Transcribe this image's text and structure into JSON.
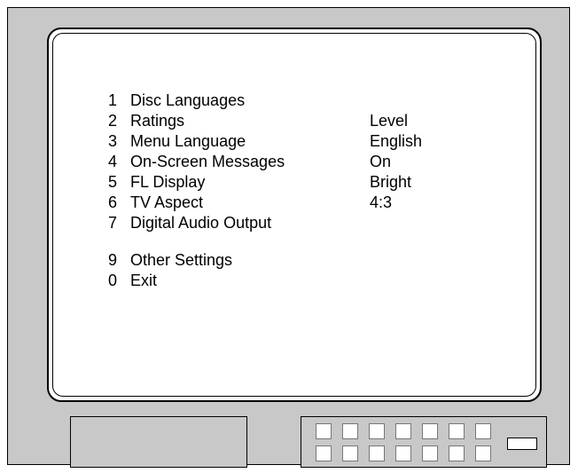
{
  "menu": {
    "items": [
      {
        "num": "1",
        "label": "Disc Languages",
        "value": ""
      },
      {
        "num": "2",
        "label": "Ratings",
        "value": "Level"
      },
      {
        "num": "3",
        "label": "Menu Language",
        "value": "English"
      },
      {
        "num": "4",
        "label": "On-Screen Messages",
        "value": "On"
      },
      {
        "num": "5",
        "label": "FL Display",
        "value": "Bright"
      },
      {
        "num": "6",
        "label": "TV Aspect",
        "value": "4:3"
      },
      {
        "num": "7",
        "label": "Digital Audio Output",
        "value": ""
      },
      {
        "num": "9",
        "label": "Other Settings",
        "value": ""
      },
      {
        "num": "0",
        "label": "Exit",
        "value": ""
      }
    ]
  },
  "colors": {
    "cabinet": "#c8c8c8",
    "screen": "#ffffff",
    "outline": "#000000"
  }
}
